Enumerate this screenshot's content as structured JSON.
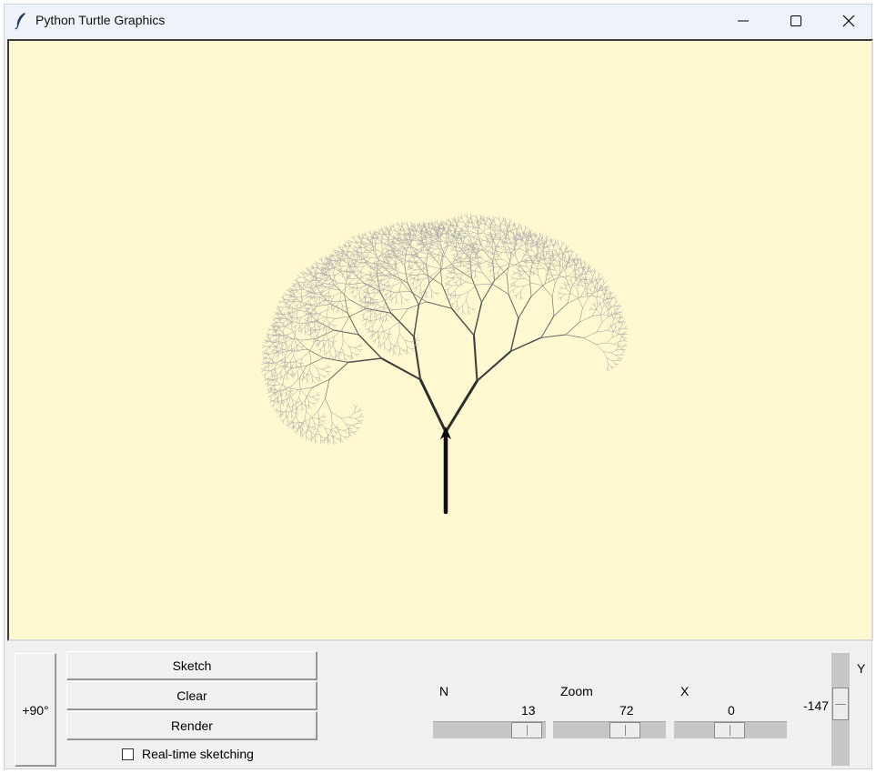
{
  "window": {
    "title": "Python Turtle Graphics",
    "icon": "feather-icon",
    "controls": [
      "minimize-icon",
      "maximize-icon",
      "close-icon"
    ]
  },
  "canvas": {
    "background": "#fff8d0",
    "drawing": "fractal-tree",
    "branch_color_dark": "#1a1a1a",
    "branch_color_light": "#a9a9a9",
    "turtle": "arrow-cursor-icon"
  },
  "controls": {
    "rotate_label": "+90°",
    "sketch_label": "Sketch",
    "clear_label": "Clear",
    "render_label": "Render",
    "realtime_label": "Real-time sketching",
    "realtime_checked": false
  },
  "sliders": {
    "n": {
      "label": "N",
      "value": "13"
    },
    "zoom": {
      "label": "Zoom",
      "value": "72"
    },
    "x": {
      "label": "X",
      "value": "0"
    },
    "y": {
      "label": "Y",
      "value": "-147"
    }
  }
}
